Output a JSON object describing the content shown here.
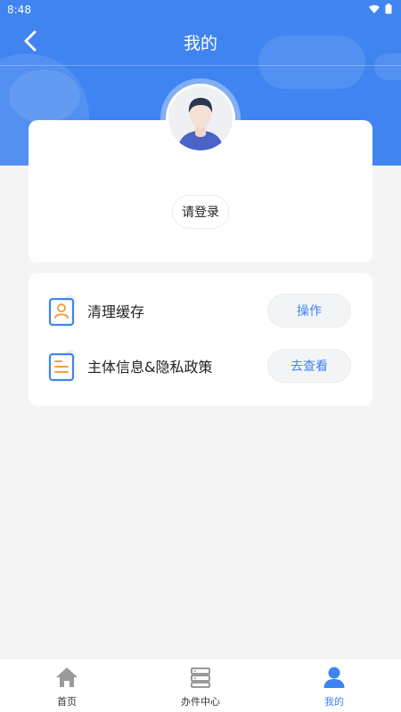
{
  "status_bar": {
    "time": "8:48"
  },
  "header": {
    "title": "我的"
  },
  "profile": {
    "login_label": "请登录"
  },
  "menu": {
    "items": [
      {
        "label": "清理缓存",
        "action": "操作",
        "icon": "user-badge-icon"
      },
      {
        "label": "主体信息&隐私政策",
        "action": "去查看",
        "icon": "document-icon"
      }
    ]
  },
  "tabbar": {
    "tabs": [
      {
        "label": "首页",
        "icon": "home-icon",
        "active": false
      },
      {
        "label": "办件中心",
        "icon": "server-icon",
        "active": false
      },
      {
        "label": "我的",
        "icon": "person-icon",
        "active": true
      }
    ]
  },
  "colors": {
    "primary": "#3f84f0",
    "background": "#f4f4f4",
    "icon_orange": "#f5a03a"
  }
}
